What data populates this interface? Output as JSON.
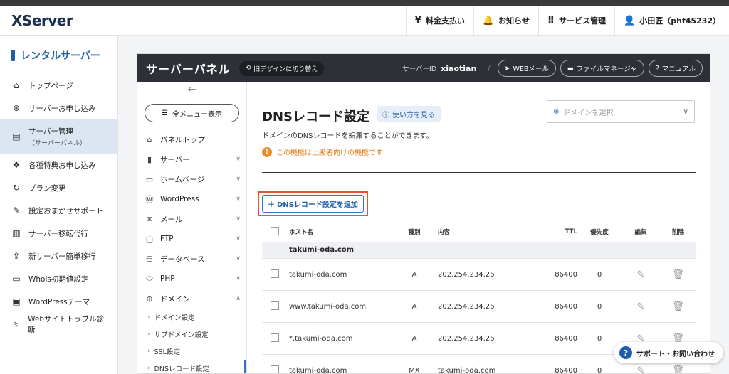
{
  "header": {
    "logo": "XServer",
    "nav": [
      {
        "icon": "yen-icon",
        "glyph": "¥",
        "label": "料金支払い"
      },
      {
        "icon": "bell-icon",
        "glyph": "🔔",
        "label": "お知らせ"
      },
      {
        "icon": "grid-icon",
        "glyph": "⠿",
        "label": "サービス管理"
      },
      {
        "icon": "user-icon",
        "glyph": "👤",
        "label": "小田匠（phf45232）"
      }
    ]
  },
  "sidebar": {
    "title": "レンタルサーバー",
    "items": [
      {
        "label": "トップページ"
      },
      {
        "label": "サーバーお申し込み"
      },
      {
        "label": "サーバー管理",
        "sub": "（サーバーパネル）"
      },
      {
        "label": "各種特典お申し込み"
      },
      {
        "label": "プラン変更"
      },
      {
        "label": "設定おまかせサポート"
      },
      {
        "label": "サーバー移転代行"
      },
      {
        "label": "新サーバー簡単移行"
      },
      {
        "label": "Whois初期値設定"
      },
      {
        "label": "WordPressテーマ"
      },
      {
        "label": "Webサイトトラブル診断"
      }
    ]
  },
  "panel": {
    "title": "サーバーパネル",
    "old_design": "旧デザインに切り替え",
    "server_id_label": "サーバーID",
    "server_id": "xiaotian",
    "buttons": [
      "WEBメール",
      "ファイルマネージャ",
      "マニュアル"
    ]
  },
  "subnav": {
    "all_menu": "全メニュー表示",
    "items": [
      "パネルトップ",
      "サーバー",
      "ホームページ",
      "WordPress",
      "メール",
      "FTP",
      "データベース",
      "PHP",
      "ドメイン"
    ],
    "sub_items": [
      "ドメイン設定",
      "サブドメイン設定",
      "SSL設定",
      "DNSレコード設定"
    ]
  },
  "content": {
    "title": "DNSレコード設定",
    "howto": "使い方を見る",
    "domain_placeholder": "ドメインを選択",
    "description": "ドメインのDNSレコードを編集することができます。",
    "warning": "この機能は上級者向けの機能です",
    "add_button": "DNSレコード設定を追加"
  },
  "table": {
    "headers": [
      "ホスト名",
      "種別",
      "内容",
      "TTL",
      "優先度",
      "編集",
      "削除"
    ],
    "group": "takumi-oda.com",
    "rows": [
      {
        "host": "takumi-oda.com",
        "type": "A",
        "content": "202.254.234.26",
        "ttl": "86400",
        "priority": "0"
      },
      {
        "host": "www.takumi-oda.com",
        "type": "A",
        "content": "202.254.234.26",
        "ttl": "86400",
        "priority": "0"
      },
      {
        "host": "*.takumi-oda.com",
        "type": "A",
        "content": "202.254.234.26",
        "ttl": "86400",
        "priority": "0"
      },
      {
        "host": "takumi-oda.com",
        "type": "MX",
        "content": "takumi-oda.com",
        "ttl": "86400",
        "priority": "0"
      }
    ]
  },
  "support": {
    "label": "サポート・お問い合わせ"
  }
}
